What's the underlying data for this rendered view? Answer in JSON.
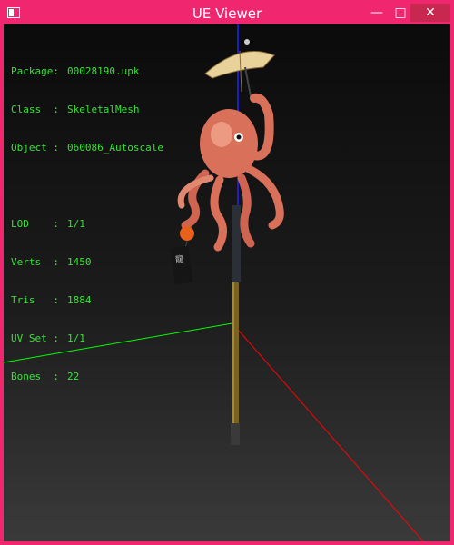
{
  "window": {
    "title": "UE Viewer",
    "minimize_glyph": "—",
    "maximize_glyph": "□",
    "close_glyph": "✕",
    "accent": "#f0266f"
  },
  "info": {
    "package_label": "Package:",
    "package_value": "00028190.upk",
    "class_label": "Class  :",
    "class_value": "SkeletalMesh",
    "object_label": "Object :",
    "object_value": "060086_Autoscale",
    "lod_label": "LOD    :",
    "lod_value": "1/1",
    "verts_label": "Verts  :",
    "verts_value": "1450",
    "tris_label": "Tris   :",
    "tris_value": "1884",
    "uvset_label": "UV Set :",
    "uvset_value": "1/1",
    "bones_label": "Bones  :",
    "bones_value": "22"
  },
  "scene": {
    "axis_colors": {
      "x": "#00ff00",
      "y": "#0000ff",
      "z": "#ff0000"
    },
    "model_icon": "octopus-umbrella-mesh-icon"
  }
}
